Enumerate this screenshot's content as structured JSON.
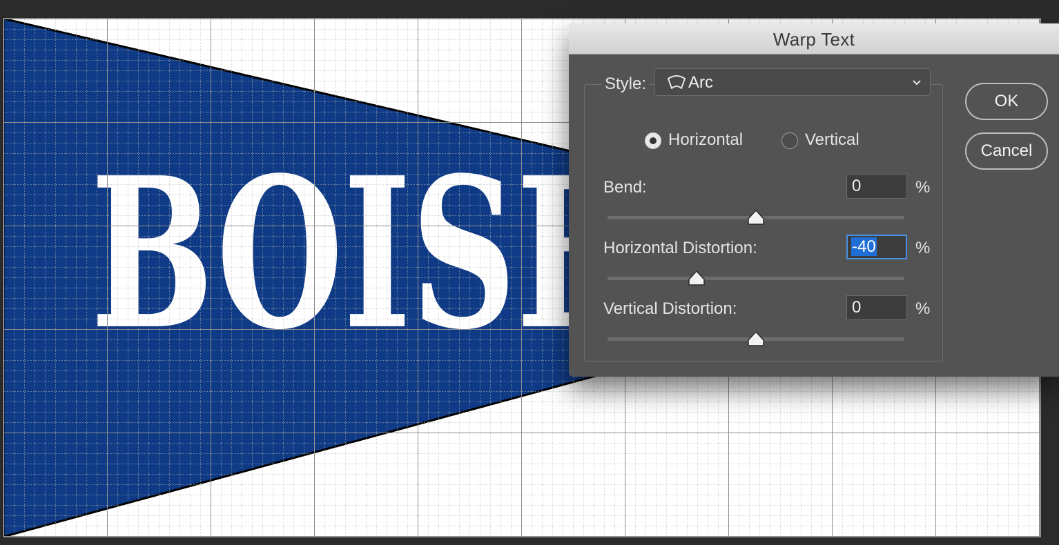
{
  "canvas": {
    "artwork_text": "BOISE",
    "pennant_color": "#0f3a85",
    "text_color": "#ffffff"
  },
  "dialog": {
    "title": "Warp Text",
    "style_label": "Style:",
    "style_value": "Arc",
    "style_icon": "arc-warp-icon",
    "orientation": {
      "horizontal_label": "Horizontal",
      "vertical_label": "Vertical",
      "selected": "Horizontal"
    },
    "bend": {
      "label": "Bend:",
      "value": "0",
      "unit": "%",
      "slider_percent": 0
    },
    "horizontal_distortion": {
      "label": "Horizontal Distortion:",
      "value": "-40",
      "unit": "%",
      "slider_percent": -40
    },
    "vertical_distortion": {
      "label": "Vertical Distortion:",
      "value": "0",
      "unit": "%",
      "slider_percent": 0
    },
    "ok_label": "OK",
    "cancel_label": "Cancel",
    "accent_color": "#1f6ed6"
  }
}
